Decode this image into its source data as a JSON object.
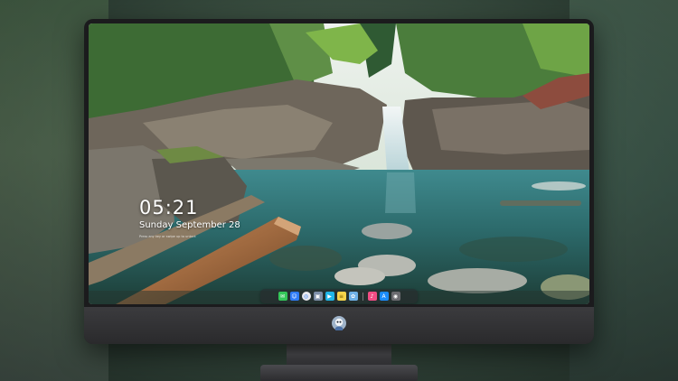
{
  "lock_screen": {
    "time": "05:21",
    "date": "Sunday September  28",
    "hint": "Press any key or swipe up to unlock"
  },
  "dock": {
    "apps": [
      {
        "name": "messages-icon",
        "color": "#34c759",
        "glyph": "✉"
      },
      {
        "name": "finder-icon",
        "color": "#2f7bf5",
        "glyph": "☺"
      },
      {
        "name": "safari-icon",
        "color": "#e9e9ee",
        "glyph": "◎"
      },
      {
        "name": "preview-icon",
        "color": "#7d8fa8",
        "glyph": "▣"
      },
      {
        "name": "videos-icon",
        "color": "#1fb6e8",
        "glyph": "▶"
      },
      {
        "name": "notes-icon",
        "color": "#f6d34a",
        "glyph": "≡"
      },
      {
        "name": "photos-icon",
        "color": "#6fb1e8",
        "glyph": "✿"
      },
      {
        "name": "music-icon",
        "color": "#f24d84",
        "glyph": "♪"
      },
      {
        "name": "app-store-icon",
        "color": "#1a8cff",
        "glyph": "A"
      },
      {
        "name": "screenshot-icon",
        "color": "#6b6b70",
        "glyph": "◉"
      }
    ]
  },
  "colors": {
    "monitor_frame": "#1b1b1d",
    "chin": "#333336",
    "water": "#2c6f73",
    "sky": "#dfe9e2"
  }
}
